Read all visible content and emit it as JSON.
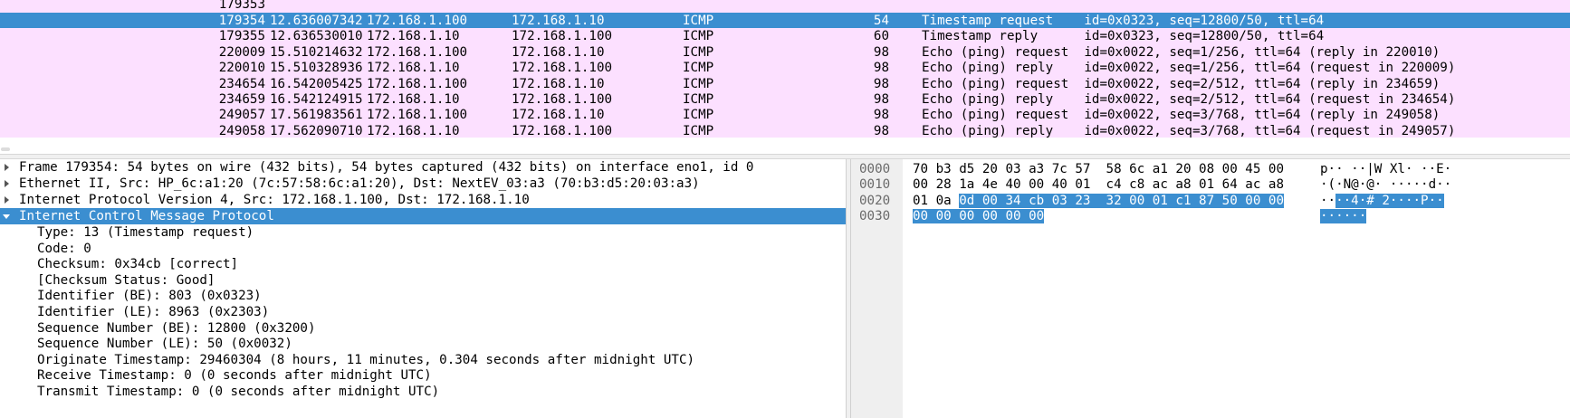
{
  "packet_list": {
    "rows": [
      {
        "no": "179354",
        "time": "12.636007342",
        "src": "172.168.1.100",
        "dst": "172.168.1.10",
        "proto": "ICMP",
        "len": "54",
        "info": "Timestamp request    id=0x0323, seq=12800/50, ttl=64",
        "selected": true
      },
      {
        "no": "179355",
        "time": "12.636530010",
        "src": "172.168.1.10",
        "dst": "172.168.1.100",
        "proto": "ICMP",
        "len": "60",
        "info": "Timestamp reply      id=0x0323, seq=12800/50, ttl=64",
        "selected": false
      },
      {
        "no": "220009",
        "time": "15.510214632",
        "src": "172.168.1.100",
        "dst": "172.168.1.10",
        "proto": "ICMP",
        "len": "98",
        "info": "Echo (ping) request  id=0x0022, seq=1/256, ttl=64 (reply in 220010)",
        "selected": false
      },
      {
        "no": "220010",
        "time": "15.510328936",
        "src": "172.168.1.10",
        "dst": "172.168.1.100",
        "proto": "ICMP",
        "len": "98",
        "info": "Echo (ping) reply    id=0x0022, seq=1/256, ttl=64 (request in 220009)",
        "selected": false
      },
      {
        "no": "234654",
        "time": "16.542005425",
        "src": "172.168.1.100",
        "dst": "172.168.1.10",
        "proto": "ICMP",
        "len": "98",
        "info": "Echo (ping) request  id=0x0022, seq=2/512, ttl=64 (reply in 234659)",
        "selected": false
      },
      {
        "no": "234659",
        "time": "16.542124915",
        "src": "172.168.1.10",
        "dst": "172.168.1.100",
        "proto": "ICMP",
        "len": "98",
        "info": "Echo (ping) reply    id=0x0022, seq=2/512, ttl=64 (request in 234654)",
        "selected": false
      },
      {
        "no": "249057",
        "time": "17.561983561",
        "src": "172.168.1.100",
        "dst": "172.168.1.10",
        "proto": "ICMP",
        "len": "98",
        "info": "Echo (ping) request  id=0x0022, seq=3/768, ttl=64 (reply in 249058)",
        "selected": false
      },
      {
        "no": "249058",
        "time": "17.562090710",
        "src": "172.168.1.10",
        "dst": "172.168.1.100",
        "proto": "ICMP",
        "len": "98",
        "info": "Echo (ping) reply    id=0x0022, seq=3/768, ttl=64 (request in 249057)",
        "selected": false
      }
    ]
  },
  "details": {
    "frame": "Frame 179354: 54 bytes on wire (432 bits), 54 bytes captured (432 bits) on interface eno1, id 0",
    "ethernet": "Ethernet II, Src: HP_6c:a1:20 (7c:57:58:6c:a1:20), Dst: NextEV_03:a3 (70:b3:d5:20:03:a3)",
    "ip": "Internet Protocol Version 4, Src: 172.168.1.100, Dst: 172.168.1.10",
    "icmp": "Internet Control Message Protocol",
    "icmp_fields": [
      "Type: 13 (Timestamp request)",
      "Code: 0",
      "Checksum: 0x34cb [correct]",
      "[Checksum Status: Good]",
      "Identifier (BE): 803 (0x0323)",
      "Identifier (LE): 8963 (0x2303)",
      "Sequence Number (BE): 12800 (0x3200)",
      "Sequence Number (LE): 50 (0x0032)",
      "Originate Timestamp: 29460304 (8 hours, 11 minutes, 0.304 seconds after midnight UTC)",
      "Receive Timestamp: 0 (0 seconds after midnight UTC)",
      "Transmit Timestamp: 0 (0 seconds after midnight UTC)"
    ]
  },
  "bytes": {
    "rows": [
      {
        "offset": "0000",
        "hex_plain": "70 b3 d5 20 03 a3 7c 57  58 6c a1 20 08 00 45 00",
        "hex_hl": "",
        "ascii_plain": "p·· ··|W Xl· ··E·",
        "ascii_hl": ""
      },
      {
        "offset": "0010",
        "hex_plain": "00 28 1a 4e 40 00 40 01  c4 c8 ac a8 01 64 ac a8",
        "hex_hl": "",
        "ascii_plain": "·(·N@·@· ·····d··",
        "ascii_hl": ""
      },
      {
        "offset": "0020",
        "hex_plain": "01 0a ",
        "hex_hl": "0d 00 34 cb 03 23  32 00 01 c1 87 50 00 00",
        "ascii_plain": "··",
        "ascii_hl": "··4·# 2····P··"
      },
      {
        "offset": "0030",
        "hex_plain": "",
        "hex_hl": "00 00 00 00 00 00",
        "ascii_plain": "",
        "ascii_hl": "······"
      }
    ]
  }
}
